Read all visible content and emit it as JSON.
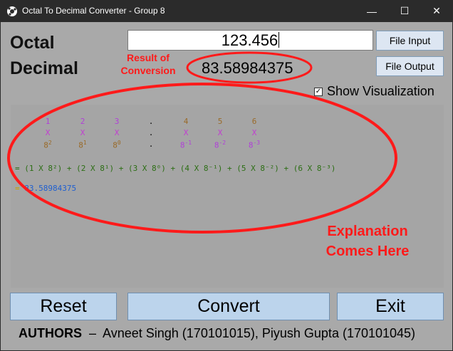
{
  "window": {
    "title": "Octal To Decimal Converter - Group 8",
    "minimize": "—",
    "maximize": "☐",
    "close": "✕"
  },
  "labels": {
    "octal": "Octal",
    "decimal": "Decimal"
  },
  "octal_input": {
    "value": "123.456"
  },
  "result": {
    "value": "83.58984375"
  },
  "buttons": {
    "file_input": "File Input",
    "file_output": "File Output",
    "reset": "Reset",
    "convert": "Convert",
    "exit": "Exit"
  },
  "visualization": {
    "checkbox_label": "Show Visualization",
    "checked": true,
    "check_glyph": "✓",
    "digits": [
      "1",
      "2",
      "3",
      ".",
      "4",
      "5",
      "6"
    ],
    "times": "X",
    "bases": [
      {
        "base": "8",
        "exp": "2"
      },
      {
        "base": "8",
        "exp": "1"
      },
      {
        "base": "8",
        "exp": "0"
      },
      {
        "base": ".",
        "exp": ""
      },
      {
        "base": "8",
        "exp": "-1"
      },
      {
        "base": "8",
        "exp": "-2"
      },
      {
        "base": "8",
        "exp": "-3"
      }
    ],
    "sum_line": "= (1 X 8²) + (2 X 8¹) + (3 X 8⁰) + (4 X 8⁻¹) + (5 X 8⁻²) + (6 X 8⁻³)",
    "eq_sign": "=",
    "result_line": "83.58984375"
  },
  "annotations": {
    "result_of_conversion_1": "Result of",
    "result_of_conversion_2": "Conversion",
    "explanation_1": "Explanation",
    "explanation_2": "Comes Here"
  },
  "authors": {
    "label": "AUTHORS",
    "dash": "–",
    "names": "Avneet Singh (170101015), Piyush Gupta (170101045)"
  },
  "colors": {
    "annotation_red": "#ff1a1a",
    "button_blue": "#bcd4ec",
    "panel_gray": "#a9a9a9"
  }
}
